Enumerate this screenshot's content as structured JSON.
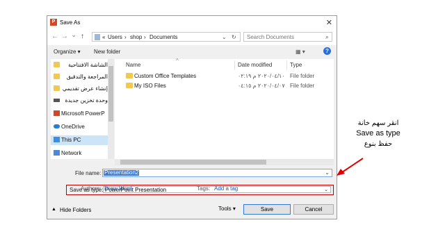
{
  "window": {
    "title": "Save As",
    "app_icon": "P",
    "close_glyph": "✕"
  },
  "nav": {
    "back": "←",
    "forward": "→",
    "dropdown": "⌄",
    "up": "↑"
  },
  "address": {
    "prefix": "«",
    "crumbs": [
      "Users",
      "shop",
      "Documents"
    ],
    "sep": "›",
    "refresh": "↻"
  },
  "search": {
    "placeholder": "Search Documents",
    "icon": "⌕"
  },
  "toolbar": {
    "organize": "Organize ▾",
    "new_folder": "New folder",
    "view": "▦ ▾",
    "help": "?"
  },
  "sidebar": {
    "items": [
      {
        "label": "الشاشة الافتتاحية",
        "icon": "folder-icon"
      },
      {
        "label": "المراجعة والتدقيق",
        "icon": "folder-icon"
      },
      {
        "label": "إنشاء عرض تقديمي",
        "icon": "folder-icon"
      },
      {
        "label": "وحدة تخزين جديدة",
        "icon": "drive-icon"
      },
      {
        "label": "Microsoft PowerP",
        "icon": "powerpoint-icon"
      },
      {
        "label": "OneDrive",
        "icon": "cloud-icon"
      },
      {
        "label": "This PC",
        "icon": "computer-icon"
      },
      {
        "label": "Network",
        "icon": "network-icon"
      }
    ]
  },
  "columns": {
    "name": "Name",
    "date": "Date modified",
    "type": "Type",
    "sort_glyph": "^"
  },
  "files": [
    {
      "name": "Custom Office Templates",
      "date": "٢٠٢٠/٠٤/١٠ م ٠٢:١٩",
      "type": "File folder"
    },
    {
      "name": "My ISO Files",
      "date": "٢٠٢٠/٠٤/٠٧ م ٠٤:١٥",
      "type": "File folder"
    }
  ],
  "form": {
    "file_name_label": "File name:",
    "file_name_value": "Presentation2",
    "save_type_label": "Save as type:",
    "save_type_value": "PowerPoint Presentation",
    "dropdown_glyph": "⌄",
    "authors_label": "Authors:",
    "authors_value": "Draw Word",
    "tags_label": "Tags:",
    "tags_value": "Add a tag"
  },
  "bottom": {
    "hide_folders": "Hide Folders",
    "hide_glyph": "▲",
    "tools": "Tools ▾",
    "save": "Save",
    "cancel": "Cancel"
  },
  "annotation": {
    "line1": "انقر سهم خانة",
    "line2": "Save as type",
    "line3": "حفظ بنوع"
  },
  "colors": {
    "highlight_border": "#c00000",
    "accent": "#3a78d8",
    "link": "#1a56b8"
  }
}
